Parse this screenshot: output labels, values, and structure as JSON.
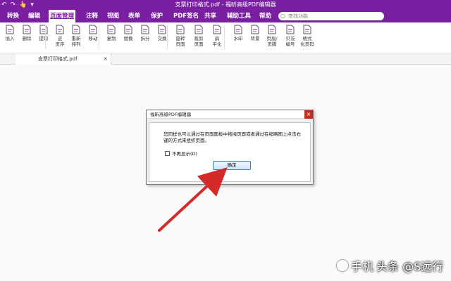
{
  "titlebar": {
    "title": "支票打印格式.pdf - 福昕高级PDF编辑器",
    "quick_access": [
      "↶",
      "↷",
      "👆",
      "▾"
    ]
  },
  "menu": {
    "items": [
      "转换",
      "编辑",
      "页面管理",
      "注释",
      "视图",
      "表单",
      "保护",
      "PDF签名",
      "共享",
      "辅助工具",
      "帮助"
    ],
    "active": "页面管理"
  },
  "search": {
    "placeholder": "查找功能"
  },
  "ribbon": {
    "tools": [
      {
        "label": "插入",
        "label2": "",
        "icon": "insert-page-icon"
      },
      {
        "label": "删除",
        "label2": "",
        "icon": "delete-page-icon"
      },
      {
        "label": "提取",
        "label2": "",
        "icon": "extract-page-icon"
      },
      {
        "label": "逆",
        "label2": "页序",
        "icon": "reverse-order-icon"
      },
      {
        "label": "重新",
        "label2": "排列",
        "icon": "rearrange-icon"
      },
      {
        "label": "移动",
        "label2": "",
        "icon": "move-page-icon"
      },
      {
        "label": "复制",
        "label2": "",
        "icon": "copy-page-icon"
      },
      {
        "label": "替换",
        "label2": "",
        "icon": "replace-page-icon"
      },
      {
        "label": "拆分",
        "label2": "",
        "icon": "split-page-icon"
      },
      {
        "label": "交换",
        "label2": "",
        "icon": "swap-page-icon"
      },
      {
        "label": "旋转",
        "label2": "页面",
        "icon": "rotate-page-icon"
      },
      {
        "label": "裁剪",
        "label2": "页面",
        "icon": "crop-page-icon"
      },
      {
        "label": "扁",
        "label2": "平化",
        "icon": "flatten-icon"
      },
      {
        "label": "水印",
        "label2": "",
        "icon": "watermark-icon"
      },
      {
        "label": "背景",
        "label2": "",
        "icon": "background-icon"
      },
      {
        "label": "页眉/",
        "label2": "页脚",
        "icon": "header-footer-icon"
      },
      {
        "label": "贝茨",
        "label2": "编号",
        "icon": "bates-number-icon"
      },
      {
        "label": "格式",
        "label2": "化页码",
        "icon": "format-page-number-icon"
      }
    ]
  },
  "tabs": [
    {
      "label": "支票打印格式.pdf",
      "close": "×"
    }
  ],
  "dialog": {
    "title": "福昕高级PDF编辑器",
    "close": "×",
    "message": "您同样也可以通过在页面面板中拖拽页面或者通过在缩略图上点击右键的方式来组织页面。",
    "checkbox_label": "不再显示(D)",
    "ok_label": "确定"
  },
  "colors": {
    "brand": "#7b1fa2",
    "arrow": "#d42a2a"
  },
  "watermark": {
    "text": "头条 @S远行",
    "prefix": "手机"
  }
}
